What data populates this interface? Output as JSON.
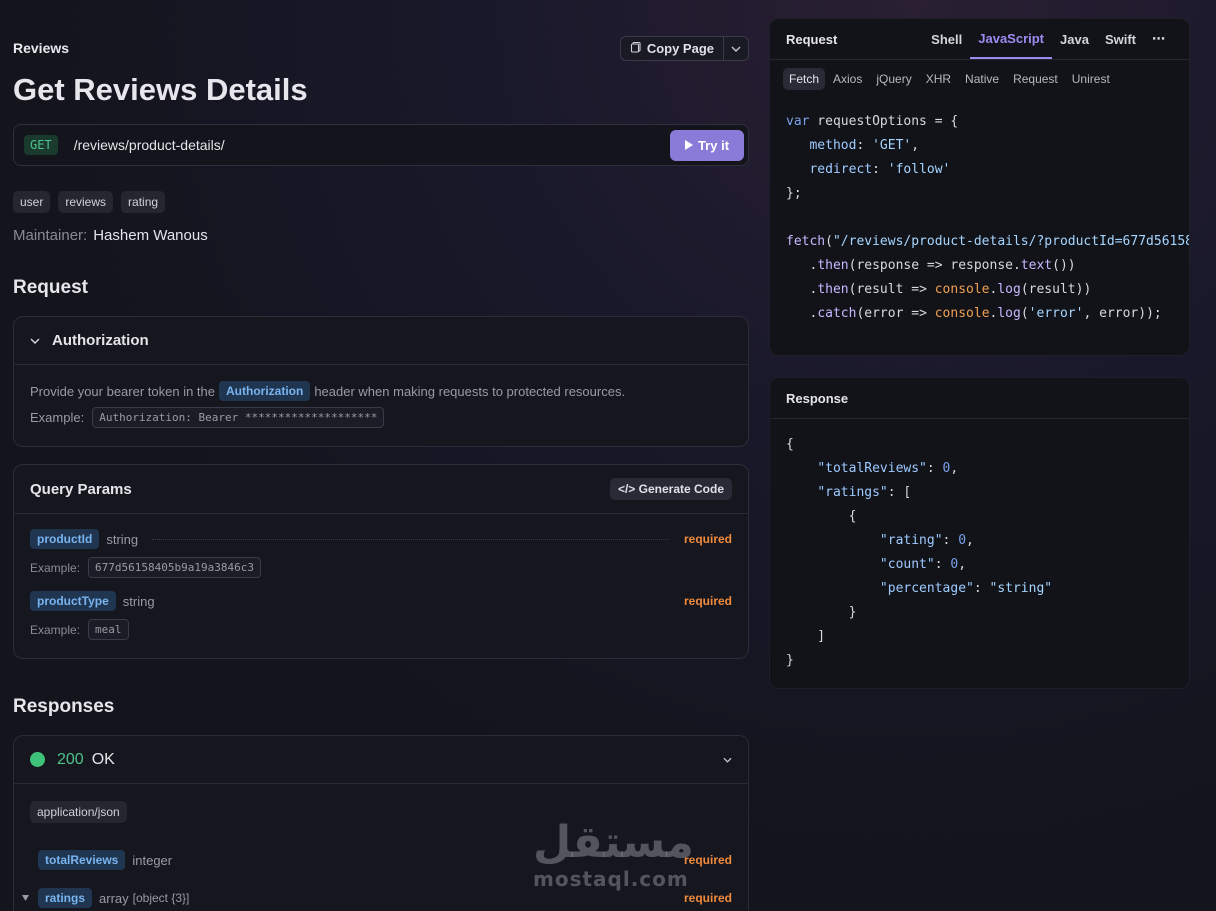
{
  "breadcrumb": "Reviews",
  "copy_page": "Copy Page",
  "title": "Get Reviews Details",
  "endpoint": {
    "method": "GET",
    "path": "/reviews/product-details/",
    "try_label": "Try it"
  },
  "tags": [
    "user",
    "reviews",
    "rating"
  ],
  "maintainer": {
    "label": "Maintainer:",
    "name": "Hashem Wanous"
  },
  "request_heading": "Request",
  "authorization": {
    "title": "Authorization",
    "text_before": "Provide your bearer token in the",
    "header_name": "Authorization",
    "text_after": "header when making requests to protected resources.",
    "example_label": "Example:",
    "example_value": "Authorization: Bearer ********************"
  },
  "query_params": {
    "title": "Query Params",
    "generate_code": "Generate Code",
    "params": [
      {
        "name": "productId",
        "type": "string",
        "required": "required",
        "example_label": "Example:",
        "example": "677d56158405b9a19a3846c3"
      },
      {
        "name": "productType",
        "type": "string",
        "required": "required",
        "example_label": "Example:",
        "example": "meal"
      }
    ]
  },
  "responses_heading": "Responses",
  "response_200": {
    "code": "200",
    "status": "OK",
    "content_type": "application/json",
    "fields": [
      {
        "name": "totalReviews",
        "type": "integer",
        "required": "required"
      },
      {
        "name": "ratings",
        "type": "array",
        "subtype": "[object {3}]",
        "required": "required"
      }
    ]
  },
  "request_panel": {
    "title": "Request",
    "languages": [
      "Shell",
      "JavaScript",
      "Java",
      "Swift"
    ],
    "active_language": "JavaScript",
    "more": "⋯",
    "libraries": [
      "Fetch",
      "Axios",
      "jQuery",
      "XHR",
      "Native",
      "Request",
      "Unirest"
    ],
    "active_library": "Fetch"
  },
  "response_panel": {
    "title": "Response"
  },
  "watermark": {
    "arabic": "مستقل",
    "latin": "mostaql.com"
  },
  "colors": {
    "accent": "#8b7bd8",
    "get_green": "#4cc38a",
    "required": "#f08a3c",
    "ok": "#3ec27a"
  }
}
